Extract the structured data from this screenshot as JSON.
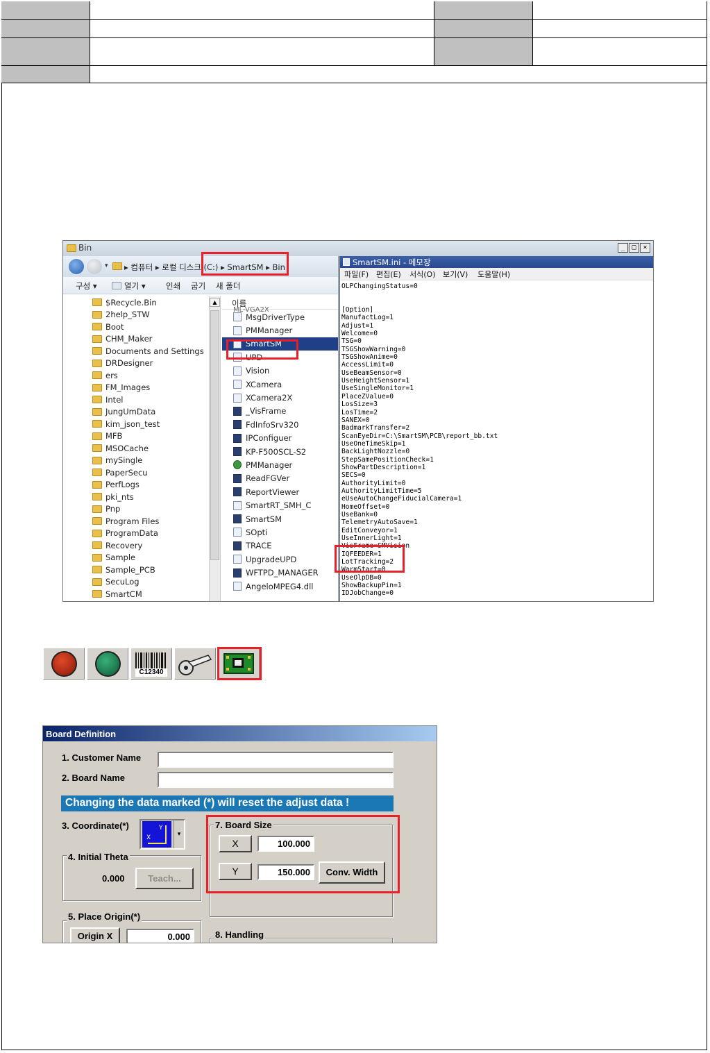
{
  "explorer": {
    "window_title": "Bin",
    "address_crumbs": "▸ 컴퓨터 ▸ 로컬 디스크 (C:) ▸ SmartSM ▸ Bin",
    "toolbar": {
      "organize": "구성 ▾",
      "open": "열기 ▾",
      "print": "인쇄",
      "burn": "굽기",
      "new_folder": "새 폴더"
    },
    "column_name": "이름",
    "tree_items": [
      "$Recycle.Bin",
      "2help_STW",
      "Boot",
      "CHM_Maker",
      "Documents and Settings",
      "DRDesigner",
      "ers",
      "FM_Images",
      "Intel",
      "JungUmData",
      "kim_json_test",
      "MFB",
      "MSOCache",
      "mySingle",
      "PaperSecu",
      "PerfLogs",
      "pki_nts",
      "Pnp",
      "Program Files",
      "ProgramData",
      "Recovery",
      "Sample",
      "Sample_PCB",
      "SecuLog",
      "SmartCM"
    ],
    "file_items": [
      "MsgDriverType",
      "PMManager",
      "SmartSM",
      "UPD",
      "Vision",
      "XCamera",
      "XCamera2X",
      "_VisFrame",
      "FdInfoSrv320",
      "IPConfiguer",
      "KP-F500SCL-S2",
      "PMManager",
      "ReadFGVer",
      "ReportViewer",
      "SmartRT_SMH_C",
      "SmartSM",
      "SOpti",
      "TRACE",
      "UpgradeUPD",
      "WFTPD_MANAGER",
      "AngeloMPEG4.dll"
    ],
    "partial_top_item": "ML-VGA2X",
    "selected_index": 2
  },
  "notepad": {
    "title": "SmartSM.ini - 메모장",
    "menu": [
      "파일(F)",
      "편집(E)",
      "서식(O)",
      "보기(V)",
      "도움말(H)"
    ],
    "lines": [
      "OLPChangingStatus=0",
      "",
      "",
      "[Option]",
      "ManufactLog=1",
      "Adjust=1",
      "Welcome=0",
      "TSG=0",
      "TSGShowWarning=0",
      "TSGShowAnime=0",
      "AccessLimit=0",
      "UseBeamSensor=0",
      "UseHeightSensor=1",
      "UseSingleMonitor=1",
      "PlaceZValue=0",
      "LosSize=3",
      "LosTime=2",
      "SANEX=0",
      "BadmarkTransfer=2",
      "ScanEyeDir=C:\\SmartSM\\PCB\\report_bb.txt",
      "UseOneTimeSkip=1",
      "BackLightNozzle=0",
      "StepSamePositionCheck=1",
      "ShowPartDescription=1",
      "SECS=0",
      "AuthorityLimit=0",
      "AuthorityLimitTime=5",
      "eUseAutoChangeFiducialCamera=1",
      "HomeOffset=0",
      "UseBank=0",
      "TelemetryAutoSave=1",
      "EditConveyor=1",
      "UseInnerLight=1",
      "VisFrame=SMVision",
      "IQFEEDER=1",
      "LotTracking=2",
      "WarmStart=0",
      "UseOlpDB=0",
      "ShowBackupPin=1",
      "IDJobChange=0"
    ]
  },
  "barcode_label": "C12340",
  "board_definition": {
    "title": "Board Definition",
    "customer_name_label": "1. Customer Name",
    "board_name_label": "2. Board Name",
    "warning": "Changing the data marked (*) will reset the adjust data !",
    "coordinate_label": "3. Coordinate(*)",
    "initial_theta_label": "4. Initial Theta",
    "initial_theta_value": "0.000",
    "teach_button": "Teach...",
    "place_origin_label": "5. Place Origin(*)",
    "origin_x_label": "Origin X",
    "origin_x_value": "0.000",
    "board_size_label": "7. Board Size",
    "x_label": "X",
    "x_value": "100.000",
    "y_label": "Y",
    "y_value": "150.000",
    "conv_width_button": "Conv. Width",
    "handling_label": "8. Handling"
  },
  "colors": {
    "highlight": "#e8202a",
    "header_gray": "#c0c0c0",
    "dialog_bg": "#d4d0c8",
    "warning_bg": "#1c78b4"
  }
}
